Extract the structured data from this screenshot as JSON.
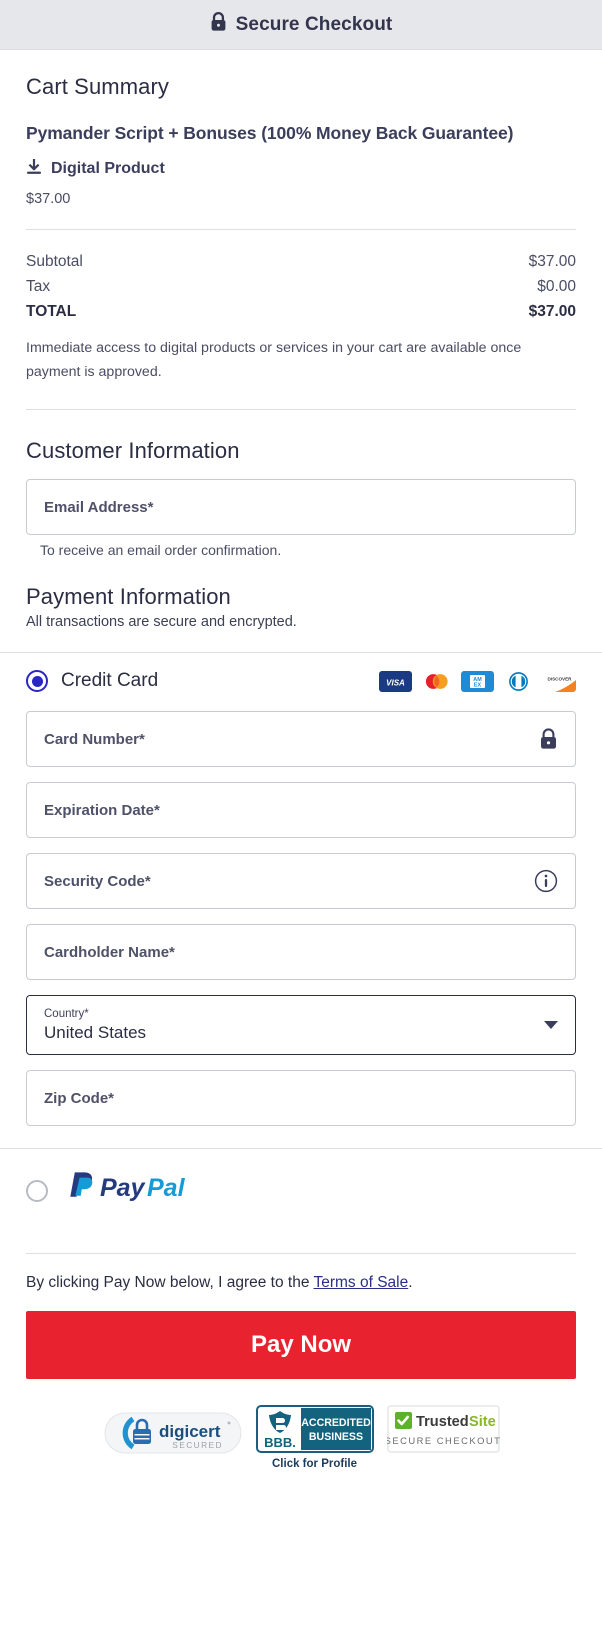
{
  "header": {
    "title": "Secure Checkout",
    "lock_icon": "lock-icon"
  },
  "cart": {
    "heading": "Cart Summary",
    "product_name": "Pymander Script + Bonuses (100% Money Back Guarantee)",
    "product_type": "Digital Product",
    "product_type_icon": "download-icon",
    "product_price": "$37.00",
    "totals": [
      {
        "label": "Subtotal",
        "value": "$37.00"
      },
      {
        "label": "Tax",
        "value": "$0.00"
      },
      {
        "label": "TOTAL",
        "value": "$37.00"
      }
    ],
    "note": "Immediate access to digital products or services in your cart are available once payment is approved."
  },
  "customer": {
    "heading": "Customer Information",
    "email_label": "Email Address*",
    "email_value": "",
    "email_hint": "To receive an email order confirmation."
  },
  "payment": {
    "heading": "Payment Information",
    "subheading": "All transactions are secure and encrypted.",
    "credit_card": {
      "label": "Credit Card",
      "selected": true,
      "brands": [
        "visa",
        "mastercard",
        "amex",
        "diners-club",
        "discover"
      ]
    },
    "fields": {
      "card_number_label": "Card Number*",
      "card_number_value": "",
      "card_number_icon": "lock-icon",
      "expiration_label": "Expiration Date*",
      "expiration_value": "",
      "security_code_label": "Security Code*",
      "security_code_value": "",
      "security_code_icon": "info-icon",
      "cardholder_label": "Cardholder Name*",
      "cardholder_value": "",
      "country_label": "Country*",
      "country_value": "United States",
      "zip_label": "Zip Code*",
      "zip_value": ""
    },
    "paypal": {
      "label": "PayPal",
      "selected": false
    }
  },
  "footer": {
    "terms_prefix": "By clicking Pay Now below, I agree to the ",
    "terms_link": "Terms of Sale",
    "terms_suffix": ".",
    "pay_button": "Pay Now"
  },
  "badges": {
    "digicert": {
      "name": "digicert",
      "word": "digicert",
      "sub": "SECURED"
    },
    "bbb": {
      "line1": "ACCREDITED",
      "line2": "BUSINESS",
      "mark": "BBB.",
      "caption": "Click for Profile"
    },
    "trustedsite": {
      "name_a": "Trusted",
      "name_b": "Site",
      "sub": "SECURE CHECKOUT"
    }
  },
  "colors": {
    "accent_red": "#e8222e",
    "radio_blue": "#2a26c4",
    "header_bg": "#e6e7eb",
    "text_dark": "#2b2d42",
    "link": "#2b2d8a"
  }
}
